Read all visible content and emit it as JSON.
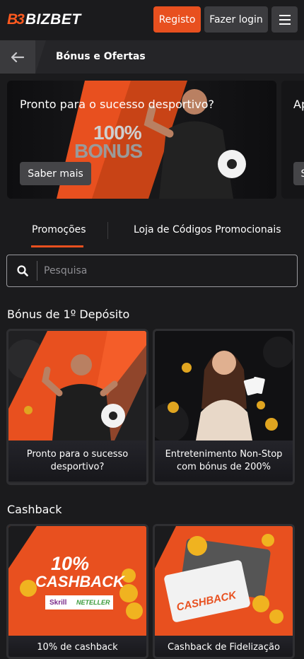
{
  "header": {
    "logo_mark": "B3",
    "logo_text": "BIZBET",
    "register_label": "Registo",
    "login_label": "Fazer login"
  },
  "subbar": {
    "title": "Bónus e Ofertas"
  },
  "slider": {
    "slides": [
      {
        "title": "Pronto para o sucesso desportivo?",
        "button": "Saber mais",
        "bonus_line1": "100%",
        "bonus_line2": "BONUS"
      },
      {
        "title": "Ap",
        "button": "S"
      }
    ]
  },
  "tabs": [
    {
      "label": "Promoções",
      "active": true
    },
    {
      "label": "Loja de Códigos Promocionais",
      "active": false
    }
  ],
  "search": {
    "placeholder": "Pesquisa"
  },
  "sections": [
    {
      "title": "Bónus de 1º Depósito",
      "cards": [
        {
          "label": "Pronto para o sucesso desportivo?"
        },
        {
          "label": "Entretenimento Non-Stop com bónus de 200%"
        }
      ]
    },
    {
      "title": "Cashback",
      "cards": [
        {
          "label": "10% de cashback",
          "graphic_line1": "10%",
          "graphic_line2": "CASHBACK",
          "partner1": "Skrill",
          "partner2": "NETELLER"
        },
        {
          "label": "Cashback de Fidelização",
          "graphic_text": "CASHBACK"
        }
      ]
    }
  ],
  "colors": {
    "accent": "#e8501f",
    "background": "#1b1b1d",
    "button_dark": "#3c3c3f"
  }
}
